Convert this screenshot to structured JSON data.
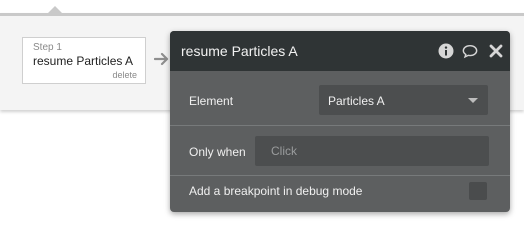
{
  "step": {
    "label": "Step 1",
    "title": "resume Particles A",
    "delete_label": "delete"
  },
  "panel": {
    "title": "resume Particles A",
    "element": {
      "label": "Element",
      "selected": "Particles A"
    },
    "only_when": {
      "label": "Only when",
      "placeholder": "Click"
    },
    "breakpoint": {
      "label": "Add a breakpoint in debug mode",
      "checked": false
    }
  },
  "icons": {
    "info": "info-icon",
    "comment": "comment-icon",
    "close": "close-icon",
    "arrow": "arrow-right-icon"
  },
  "colors": {
    "panel_background": "#5d5f60",
    "panel_header": "#2f3435",
    "field_background": "#4c4e4f"
  }
}
